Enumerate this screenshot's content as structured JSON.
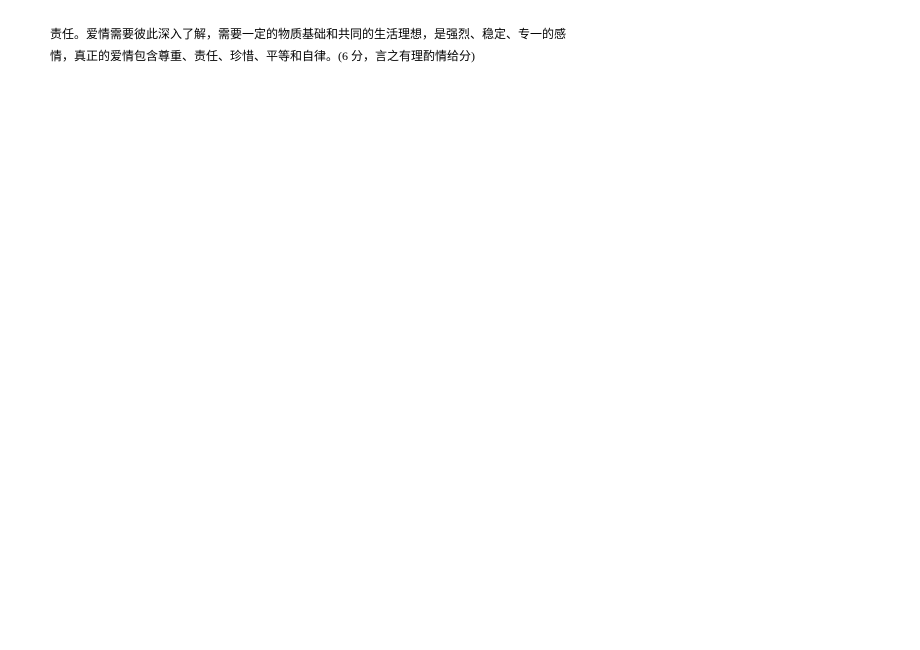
{
  "document": {
    "line1": "责任。爱情需要彼此深入了解，需要一定的物质基础和共同的生活理想，是强烈、稳定、专一的感",
    "line2": "情，真正的爱情包含尊重、责任、珍惜、平等和自律。(6 分，言之有理酌情给分)"
  }
}
